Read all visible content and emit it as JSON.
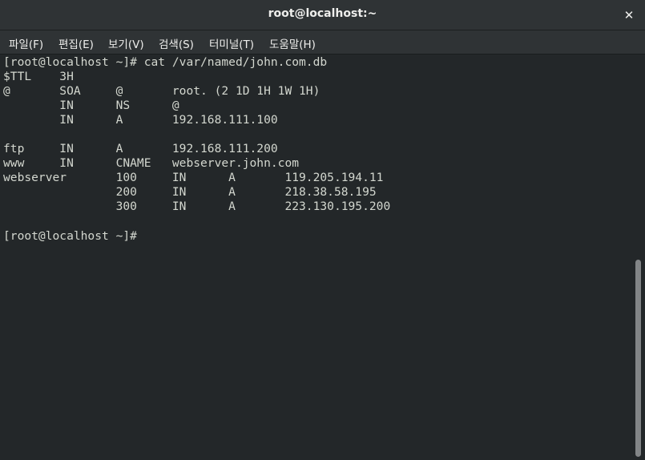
{
  "window": {
    "title": "root@localhost:~",
    "close_glyph": "✕"
  },
  "menu": {
    "items": [
      {
        "label": "파일(F)"
      },
      {
        "label": "편집(E)"
      },
      {
        "label": "보기(V)"
      },
      {
        "label": "검색(S)"
      },
      {
        "label": "터미널(T)"
      },
      {
        "label": "도움말(H)"
      }
    ]
  },
  "terminal": {
    "lines": [
      "[root@localhost ~]# cat /var/named/john.com.db",
      "$TTL    3H",
      "@       SOA     @       root. (2 1D 1H 1W 1H)",
      "        IN      NS      @",
      "        IN      A       192.168.111.100",
      "",
      "ftp     IN      A       192.168.111.200",
      "www     IN      CNAME   webserver.john.com",
      "webserver       100     IN      A       119.205.194.11",
      "                200     IN      A       218.38.58.195",
      "                300     IN      A       223.130.195.200",
      "",
      "[root@localhost ~]#"
    ]
  },
  "colors": {
    "background": "#232729",
    "text": "#d3d7cf",
    "titlebar": "#2f3335"
  }
}
